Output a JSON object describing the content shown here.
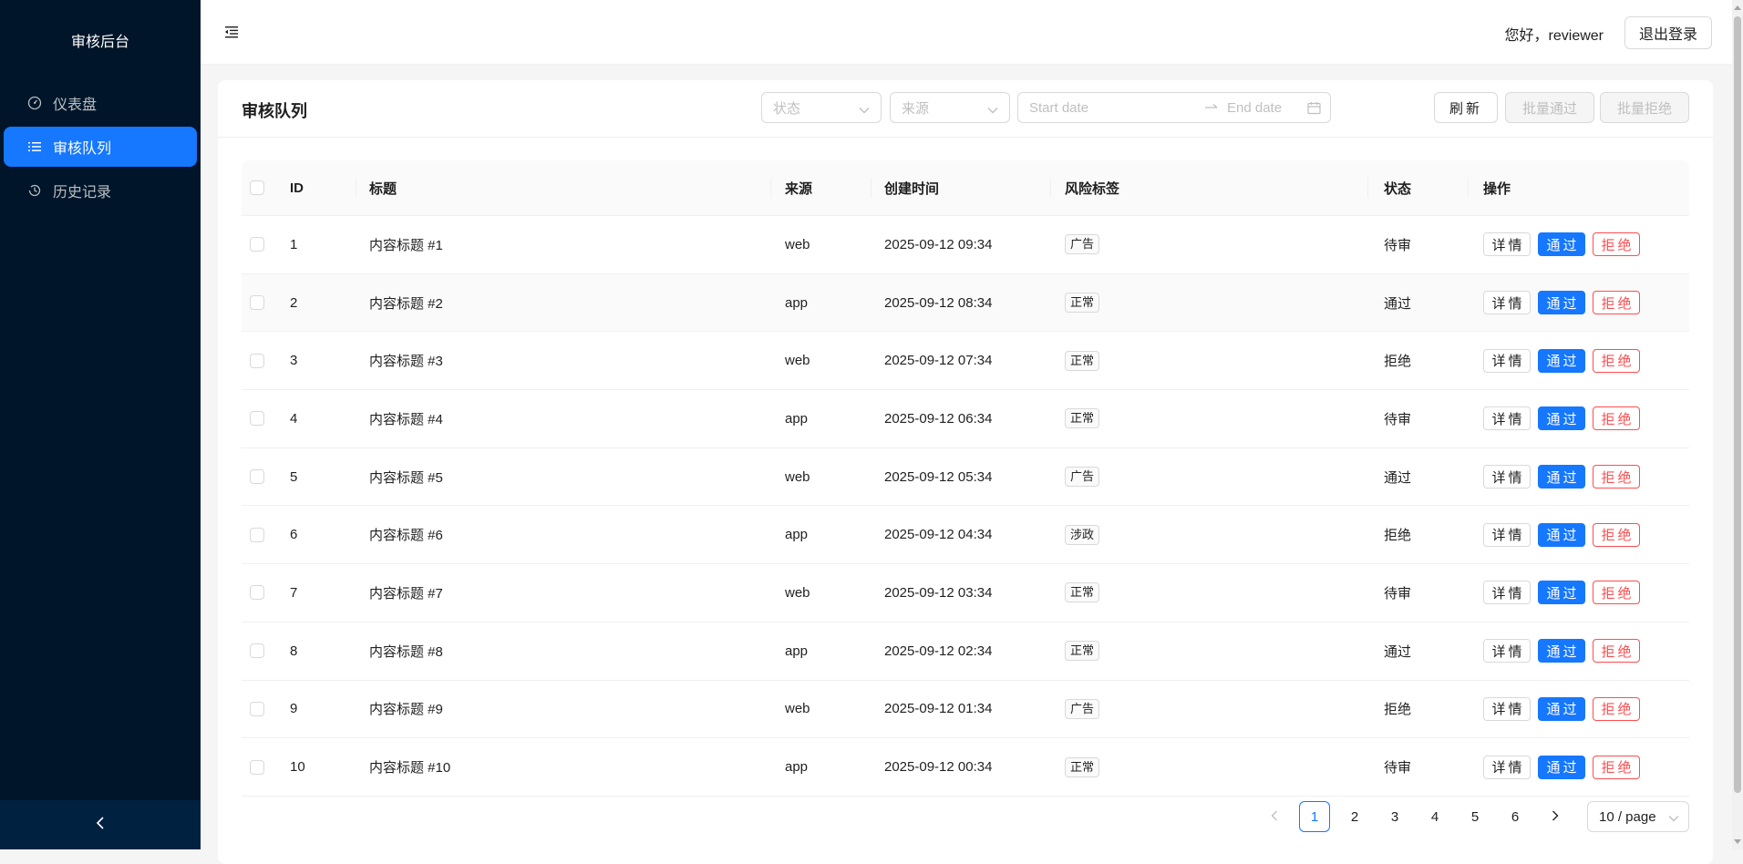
{
  "sidebar": {
    "title": "审核后台",
    "items": [
      {
        "label": "仪表盘",
        "icon": "dashboard-icon"
      },
      {
        "label": "审核队列",
        "icon": "list-icon",
        "active": true
      },
      {
        "label": "历史记录",
        "icon": "history-icon"
      }
    ]
  },
  "header": {
    "greeting": "您好，reviewer",
    "logout_label": "退出登录"
  },
  "card": {
    "title": "审核队列",
    "filters": {
      "status_placeholder": "状态",
      "source_placeholder": "来源",
      "start_placeholder": "Start date",
      "end_placeholder": "End date"
    },
    "buttons": {
      "refresh": "刷新",
      "batch_approve": "批量通过",
      "batch_reject": "批量拒绝"
    }
  },
  "table": {
    "columns": [
      "ID",
      "标题",
      "来源",
      "创建时间",
      "风险标签",
      "状态",
      "操作"
    ],
    "action_labels": {
      "detail": "详情",
      "approve": "通过",
      "reject": "拒绝"
    },
    "rows": [
      {
        "id": "1",
        "title": "内容标题 #1",
        "source": "web",
        "created": "2025-09-12 09:34",
        "tag": "广告",
        "status": "待审"
      },
      {
        "id": "2",
        "title": "内容标题 #2",
        "source": "app",
        "created": "2025-09-12 08:34",
        "tag": "正常",
        "status": "通过"
      },
      {
        "id": "3",
        "title": "内容标题 #3",
        "source": "web",
        "created": "2025-09-12 07:34",
        "tag": "正常",
        "status": "拒绝"
      },
      {
        "id": "4",
        "title": "内容标题 #4",
        "source": "app",
        "created": "2025-09-12 06:34",
        "tag": "正常",
        "status": "待审"
      },
      {
        "id": "5",
        "title": "内容标题 #5",
        "source": "web",
        "created": "2025-09-12 05:34",
        "tag": "广告",
        "status": "通过"
      },
      {
        "id": "6",
        "title": "内容标题 #6",
        "source": "app",
        "created": "2025-09-12 04:34",
        "tag": "涉政",
        "status": "拒绝"
      },
      {
        "id": "7",
        "title": "内容标题 #7",
        "source": "web",
        "created": "2025-09-12 03:34",
        "tag": "正常",
        "status": "待审"
      },
      {
        "id": "8",
        "title": "内容标题 #8",
        "source": "app",
        "created": "2025-09-12 02:34",
        "tag": "正常",
        "status": "通过"
      },
      {
        "id": "9",
        "title": "内容标题 #9",
        "source": "web",
        "created": "2025-09-12 01:34",
        "tag": "广告",
        "status": "拒绝"
      },
      {
        "id": "10",
        "title": "内容标题 #10",
        "source": "app",
        "created": "2025-09-12 00:34",
        "tag": "正常",
        "status": "待审"
      }
    ]
  },
  "pagination": {
    "pages": [
      "1",
      "2",
      "3",
      "4",
      "5",
      "6"
    ],
    "current": "1",
    "page_size": "10 / page"
  },
  "colors": {
    "sidebar_bg": "#001529",
    "primary": "#1677ff",
    "danger": "#ff4d4f"
  }
}
